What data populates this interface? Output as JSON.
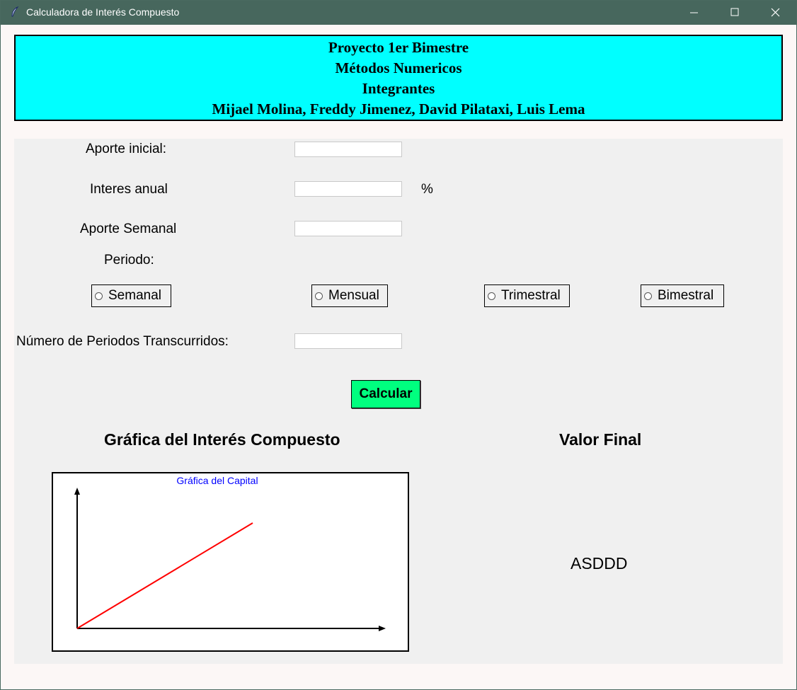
{
  "window": {
    "title": "Calculadora de Interés Compuesto",
    "icons": {
      "app": "feather-icon",
      "minimize": "minimize-icon",
      "maximize": "maximize-icon",
      "close": "close-icon"
    }
  },
  "header": {
    "line1": "Proyecto 1er Bimestre",
    "line2": "Métodos Numericos",
    "line3": "Integrantes",
    "line4": "Mijael Molina, Freddy Jimenez, David Pilataxi, Luis Lema",
    "background_color": "#00ffff"
  },
  "form": {
    "aporte_inicial_label": "Aporte inicial:",
    "aporte_inicial_value": "",
    "interes_anual_label": "Interes anual",
    "interes_anual_value": "",
    "percent_symbol": "%",
    "aporte_semanal_label": "Aporte Semanal",
    "aporte_semanal_value": "",
    "periodo_label": "Periodo:",
    "periodos": [
      "Semanal",
      "Mensual",
      "Trimestral",
      "Bimestral"
    ],
    "numero_periodos_label": "Número de Periodos Transcurridos:",
    "numero_periodos_value": ""
  },
  "calcular": {
    "label": "Calcular",
    "color": "#00ff7f"
  },
  "grafica": {
    "section_title": "Gráfica del Interés Compuesto",
    "canvas_title": "Gráfica del Capital",
    "line_color": "#ff0000",
    "title_color": "#0000ff"
  },
  "resultado": {
    "section_title": "Valor Final",
    "value": "ASDDD"
  }
}
